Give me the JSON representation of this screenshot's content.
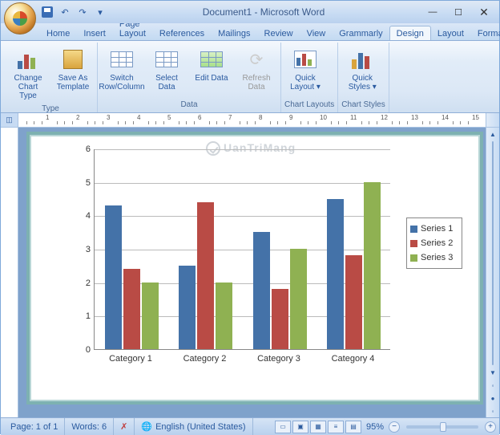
{
  "title": "Document1 - Microsoft Word",
  "qat": {
    "save": "Save",
    "undo": "↶",
    "redo": "↷",
    "dropdown": "▾"
  },
  "tabs": [
    "Home",
    "Insert",
    "Page Layout",
    "References",
    "Mailings",
    "Review",
    "View",
    "Grammarly",
    "Design",
    "Layout",
    "Format"
  ],
  "active_tab_index": 8,
  "ribbon": {
    "groups": [
      {
        "label": "Type",
        "buttons": [
          {
            "name": "change-chart-type",
            "label": "Change Chart Type"
          },
          {
            "name": "save-as-template",
            "label": "Save As Template"
          }
        ]
      },
      {
        "label": "Data",
        "buttons": [
          {
            "name": "switch-row-column",
            "label": "Switch Row/Column"
          },
          {
            "name": "select-data",
            "label": "Select Data"
          },
          {
            "name": "edit-data",
            "label": "Edit Data"
          },
          {
            "name": "refresh-data",
            "label": "Refresh Data",
            "disabled": true
          }
        ]
      },
      {
        "label": "Chart Layouts",
        "buttons": [
          {
            "name": "quick-layout",
            "label": "Quick Layout ▾"
          }
        ]
      },
      {
        "label": "Chart Styles",
        "buttons": [
          {
            "name": "quick-styles",
            "label": "Quick Styles ▾"
          }
        ]
      }
    ]
  },
  "statusbar": {
    "page": "Page: 1 of 1",
    "words": "Words: 6",
    "language": "English (United States)",
    "zoom": "95%"
  },
  "watermark": "UanTriMang",
  "chart_data": {
    "type": "bar",
    "categories": [
      "Category 1",
      "Category 2",
      "Category 3",
      "Category 4"
    ],
    "series": [
      {
        "name": "Series 1",
        "color": "#4472a8",
        "values": [
          4.3,
          2.5,
          3.5,
          4.5
        ]
      },
      {
        "name": "Series 2",
        "color": "#b94b45",
        "values": [
          2.4,
          4.4,
          1.8,
          2.8
        ]
      },
      {
        "name": "Series 3",
        "color": "#8fb152",
        "values": [
          2.0,
          2.0,
          3.0,
          5.0
        ]
      }
    ],
    "ylim": [
      0,
      6
    ],
    "yticks": [
      0,
      1,
      2,
      3,
      4,
      5,
      6
    ],
    "title": "",
    "xlabel": "",
    "ylabel": ""
  }
}
